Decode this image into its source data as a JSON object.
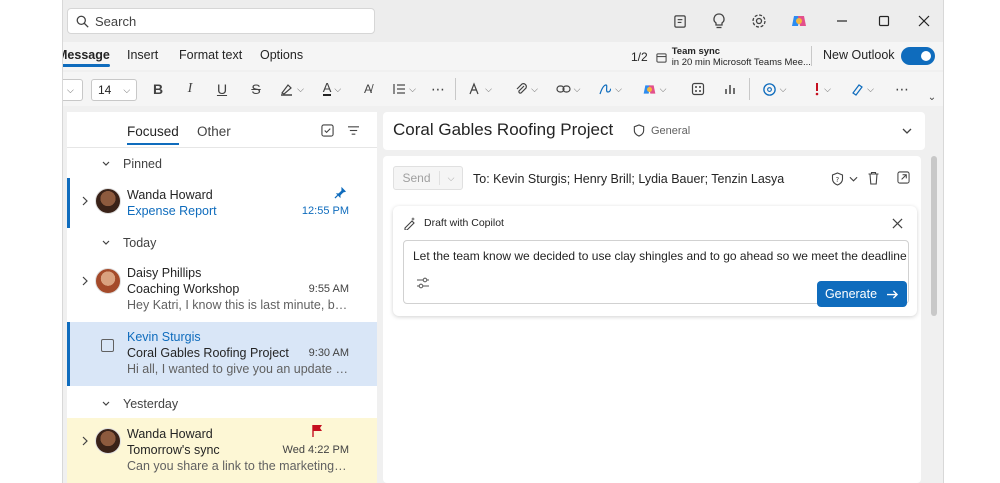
{
  "search": {
    "placeholder": "Search"
  },
  "ribbon": {
    "tabs": [
      "Message",
      "Insert",
      "Format text",
      "Options"
    ],
    "meeting": {
      "count": "1/2",
      "title": "Team sync",
      "detail": "in 20 min Microsoft Teams Mee..."
    },
    "new_outlook_label": "New Outlook",
    "new_outlook_on": true
  },
  "toolbar": {
    "font_size": "14"
  },
  "list": {
    "tabs": {
      "focused": "Focused",
      "other": "Other"
    },
    "groups": {
      "pinned": "Pinned",
      "today": "Today",
      "yesterday": "Yesterday"
    },
    "items": [
      {
        "sender": "Wanda Howard",
        "subject": "Expense Report",
        "preview": "",
        "time": "12:55 PM",
        "pinned": true
      },
      {
        "sender": "Daisy Phillips",
        "subject": "Coaching Workshop",
        "preview": "Hey Katri, I know this is last minute, but do...",
        "time": "9:55 AM"
      },
      {
        "sender": "Kevin Sturgis",
        "subject": "Coral Gables Roofing Project",
        "preview": "Hi all, I wanted to give you an update on t...",
        "time": "9:30 AM",
        "selected": true
      },
      {
        "sender": "Wanda Howard",
        "subject": "Tomorrow's sync",
        "preview": "Can you share a link to the marketing doc...",
        "time": "Wed 4:22 PM",
        "flagged": true
      }
    ]
  },
  "reading": {
    "title": "Coral Gables Roofing Project",
    "label": "General",
    "send": "Send",
    "to": "To: Kevin Sturgis; Henry Brill; Lydia Bauer; Tenzin Lasya",
    "copilot": {
      "title": "Draft with Copilot",
      "prompt": "Let the team know we decided to use clay shingles and to go ahead so we meet the deadline",
      "generate": "Generate"
    }
  },
  "colors": {
    "accent": "#0f6cbd",
    "selected_bg": "#d9e6f7",
    "flagged_bg": "#fdf7d5",
    "flag": "#c50f1f"
  }
}
